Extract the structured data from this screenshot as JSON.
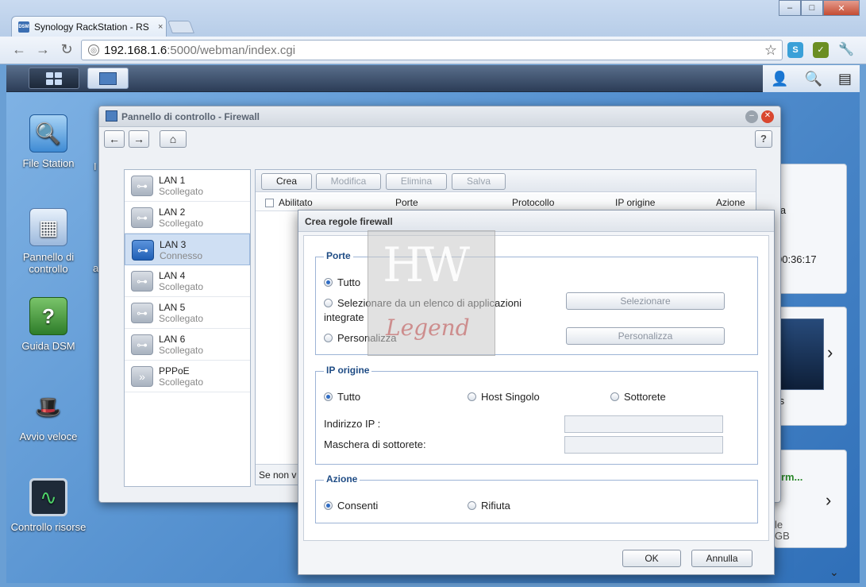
{
  "browser": {
    "tab_title": "Synology RackStation - RS",
    "tab_close": "×",
    "favicon_text": "DSM",
    "url_host": "192.168.1.6",
    "url_rest": ":5000/webman/index.cgi",
    "star": "☆",
    "back": "←",
    "forward": "→",
    "reload": "↻",
    "win_min": "–",
    "win_max": "□",
    "win_close": "✕"
  },
  "dsm": {
    "right_icons": [
      "👤",
      "🔍",
      "▤"
    ]
  },
  "desktop": {
    "icons": [
      {
        "label": "File Station",
        "glyph": "🔍"
      },
      {
        "label": "Pannello di controllo",
        "glyph": "▦"
      },
      {
        "label": "Guida DSM",
        "glyph": "?"
      },
      {
        "label": "Avvio veloce",
        "glyph": "🎩"
      },
      {
        "label": "Controllo risorse",
        "glyph": "∿"
      }
    ],
    "partial_i": "I",
    "partial_a": "a"
  },
  "widgets": {
    "w1_text": "ia",
    "w1_time": "00:36:17",
    "w2_text": "/s",
    "w3_title": "orm...",
    "w3_line1": "le",
    "w3_line2": "GB",
    "chevron": "›"
  },
  "control_panel": {
    "title": "Pannello di controllo - Firewall",
    "help": "?",
    "nav_back": "←",
    "nav_forward": "→",
    "nav_home": "⌂",
    "interfaces": [
      {
        "name": "LAN 1",
        "status": "Scollegato"
      },
      {
        "name": "LAN 2",
        "status": "Scollegato"
      },
      {
        "name": "LAN 3",
        "status": "Connesso"
      },
      {
        "name": "LAN 4",
        "status": "Scollegato"
      },
      {
        "name": "LAN 5",
        "status": "Scollegato"
      },
      {
        "name": "LAN 6",
        "status": "Scollegato"
      },
      {
        "name": "PPPoE",
        "status": "Scollegato"
      }
    ],
    "toolbar": {
      "create": "Crea",
      "edit": "Modifica",
      "delete": "Elimina",
      "save": "Salva"
    },
    "columns": [
      "Abilitato",
      "Porte",
      "Protocollo",
      "IP origine",
      "Azione"
    ],
    "footer_text": "Se non v"
  },
  "dialog": {
    "title": "Crea regole firewall",
    "ports": {
      "legend": "Porte",
      "all": "Tutto",
      "select_app": "Selezionare da un elenco di applicazioni",
      "select_app_line2": "integrate",
      "custom": "Personalizza",
      "select_button": "Selezionare",
      "custom_button": "Personalizza"
    },
    "source_ip": {
      "legend": "IP origine",
      "all": "Tutto",
      "single_host": "Host Singolo",
      "subnet": "Sottorete",
      "ip_label": "Indirizzo IP :",
      "mask_label": "Maschera di sottorete:"
    },
    "action": {
      "legend": "Azione",
      "allow": "Consenti",
      "deny": "Rifiuta"
    },
    "ok": "OK",
    "cancel": "Annulla"
  },
  "watermark": {
    "hw": "HW",
    "legend": "Legend"
  },
  "scroll_icon": "⌄"
}
